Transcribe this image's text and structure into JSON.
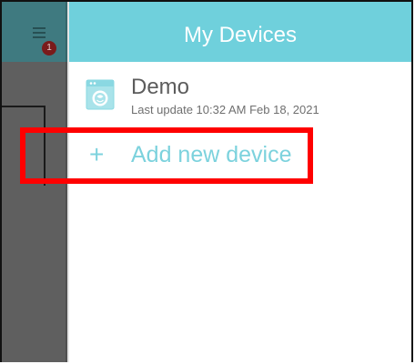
{
  "colors": {
    "accent": "#6fd0dc",
    "highlight": "#ff0000"
  },
  "left_pane": {
    "menu_icon": "hamburger-icon",
    "notification_count": "1"
  },
  "drawer": {
    "title": "My Devices",
    "devices": [
      {
        "icon": "washing-machine-icon",
        "name": "Demo",
        "last_update": "Last update 10:32 AM Feb 18, 2021"
      }
    ],
    "add_device": {
      "icon": "plus-icon",
      "label": "Add new device"
    }
  }
}
